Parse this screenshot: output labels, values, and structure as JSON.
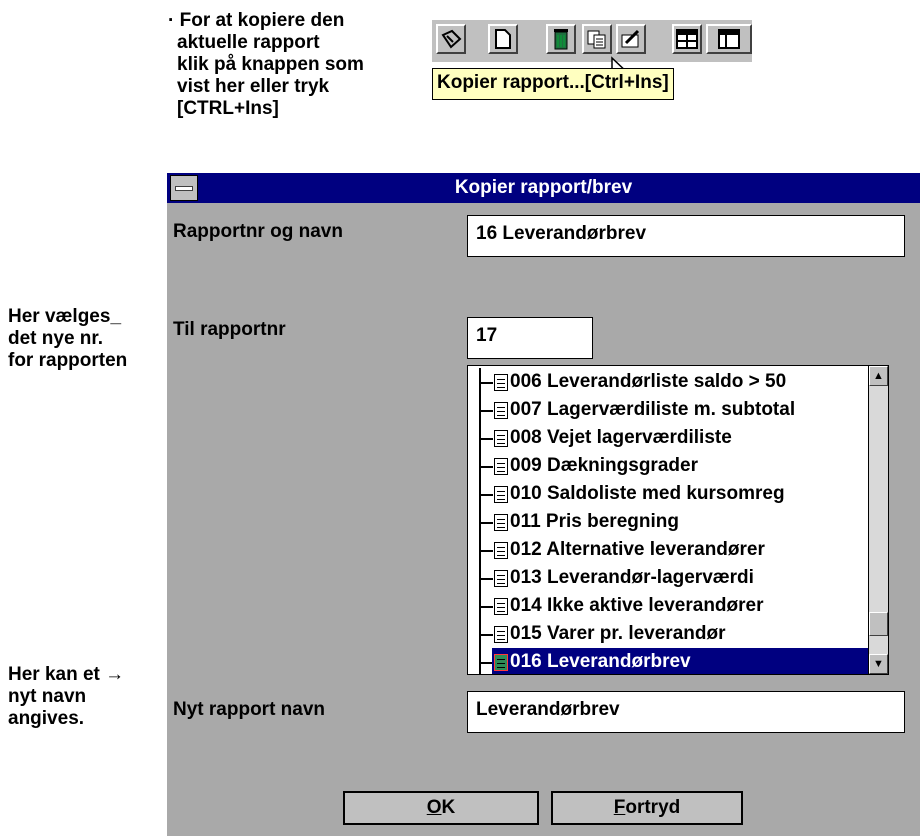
{
  "top_note": {
    "lines": [
      "· For at kopiere den",
      "aktuelle rapport",
      "klik på knappen som",
      "vist her eller tryk",
      "[CTRL+Ins]"
    ]
  },
  "toolbar": {
    "icons": [
      "report-icon",
      "new-page-icon",
      "trash-icon",
      "copy-report-icon",
      "edit-icon",
      "window-icon",
      "window-icon"
    ],
    "tooltip": "Kopier rapport...[Ctrl+Ins]"
  },
  "left_notes": {
    "report_nr": [
      "Her vælges_",
      "det nye nr.",
      "for rapporten"
    ],
    "new_name": [
      "Her kan et →",
      "nyt navn",
      "angives."
    ]
  },
  "dialog": {
    "title": "Kopier rapport/brev",
    "report_label": "Rapportnr og navn",
    "report_value": "16 Leverandørbrev",
    "to_report_label": "Til rapportnr",
    "to_report_value": "17",
    "list_items": [
      "006 Leverandørliste saldo > 50",
      "007 Lagerværdiliste m. subtotal",
      "008 Vejet lagerværdiliste",
      "009 Dækningsgrader",
      "010 Saldoliste med kursomreg",
      "011 Pris beregning",
      "012 Alternative leverandører",
      "013 Leverandør-lagerværdi",
      "014 Ikke aktive leverandører",
      "015 Varer pr. leverandør",
      "016 Leverandørbrev"
    ],
    "selected_item": "016 Leverandørbrev",
    "new_name_label": "Nyt rapport navn",
    "new_name_value": "Leverandørbrev",
    "ok_accel": "O",
    "ok_rest": "K",
    "cancel_accel": "F",
    "cancel_rest": "ortryd"
  },
  "colors": {
    "titlebar": "#000080",
    "dialog_bg": "#a9a9a9",
    "tooltip_bg": "#ffffc0",
    "selection": "#000080"
  }
}
